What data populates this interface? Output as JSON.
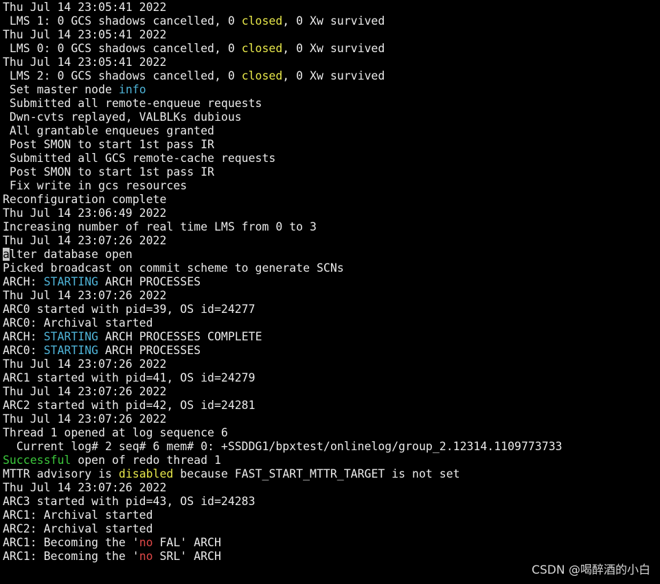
{
  "colors": {
    "background": "#000000",
    "text": "#ebebeb",
    "yellow": "#e8e84a",
    "cyan": "#4fb4d8",
    "green": "#3cc83c",
    "red": "#e04848",
    "cursor": "#c8c8c8"
  },
  "lines": [
    [
      {
        "t": "Thu Jul 14 23:05:41 2022"
      }
    ],
    [
      {
        "t": " LMS 1: 0 GCS shadows cancelled, 0 "
      },
      {
        "t": "closed",
        "c": "yellow"
      },
      {
        "t": ", 0 Xw survived"
      }
    ],
    [
      {
        "t": "Thu Jul 14 23:05:41 2022"
      }
    ],
    [
      {
        "t": " LMS 0: 0 GCS shadows cancelled, 0 "
      },
      {
        "t": "closed",
        "c": "yellow"
      },
      {
        "t": ", 0 Xw survived"
      }
    ],
    [
      {
        "t": "Thu Jul 14 23:05:41 2022"
      }
    ],
    [
      {
        "t": " LMS 2: 0 GCS shadows cancelled, 0 "
      },
      {
        "t": "closed",
        "c": "yellow"
      },
      {
        "t": ", 0 Xw survived"
      }
    ],
    [
      {
        "t": " Set master node "
      },
      {
        "t": "info",
        "c": "cyan"
      }
    ],
    [
      {
        "t": " Submitted all remote-enqueue requests"
      }
    ],
    [
      {
        "t": " Dwn-cvts replayed, VALBLKs dubious"
      }
    ],
    [
      {
        "t": " All grantable enqueues granted"
      }
    ],
    [
      {
        "t": " Post SMON to start 1st pass IR"
      }
    ],
    [
      {
        "t": " Submitted all GCS remote-cache requests"
      }
    ],
    [
      {
        "t": " Post SMON to start 1st pass IR"
      }
    ],
    [
      {
        "t": " Fix write in gcs resources"
      }
    ],
    [
      {
        "t": "Reconfiguration complete"
      }
    ],
    [
      {
        "t": "Thu Jul 14 23:06:49 2022"
      }
    ],
    [
      {
        "t": "Increasing number of real time LMS from 0 to 3"
      }
    ],
    [
      {
        "t": "Thu Jul 14 23:07:26 2022"
      }
    ],
    [
      {
        "t": "a",
        "c": "cursor"
      },
      {
        "t": "lter database open"
      }
    ],
    [
      {
        "t": "Picked broadcast on commit scheme to generate SCNs"
      }
    ],
    [
      {
        "t": "ARCH: "
      },
      {
        "t": "STARTING",
        "c": "cyan"
      },
      {
        "t": " ARCH PROCESSES"
      }
    ],
    [
      {
        "t": "Thu Jul 14 23:07:26 2022"
      }
    ],
    [
      {
        "t": "ARC0 started with pid=39, OS id=24277"
      }
    ],
    [
      {
        "t": "ARC0: Archival started"
      }
    ],
    [
      {
        "t": "ARCH: "
      },
      {
        "t": "STARTING",
        "c": "cyan"
      },
      {
        "t": " ARCH PROCESSES COMPLETE"
      }
    ],
    [
      {
        "t": "ARC0: "
      },
      {
        "t": "STARTING",
        "c": "cyan"
      },
      {
        "t": " ARCH PROCESSES"
      }
    ],
    [
      {
        "t": "Thu Jul 14 23:07:26 2022"
      }
    ],
    [
      {
        "t": "ARC1 started with pid=41, OS id=24279"
      }
    ],
    [
      {
        "t": "Thu Jul 14 23:07:26 2022"
      }
    ],
    [
      {
        "t": "ARC2 started with pid=42, OS id=24281"
      }
    ],
    [
      {
        "t": "Thu Jul 14 23:07:26 2022"
      }
    ],
    [
      {
        "t": "Thread 1 opened at log sequence 6"
      }
    ],
    [
      {
        "t": "  Current log# 2 seq# 6 mem# 0: +SSDDG1/bpxtest/onlinelog/group_2.12314.1109773733"
      }
    ],
    [
      {
        "t": "Successful",
        "c": "green"
      },
      {
        "t": " open of redo thread 1"
      }
    ],
    [
      {
        "t": "MTTR advisory is "
      },
      {
        "t": "disabled",
        "c": "yellow"
      },
      {
        "t": " because FAST_START_MTTR_TARGET is not set"
      }
    ],
    [
      {
        "t": "Thu Jul 14 23:07:26 2022"
      }
    ],
    [
      {
        "t": "ARC3 started with pid=43, OS id=24283"
      }
    ],
    [
      {
        "t": "ARC1: Archival started"
      }
    ],
    [
      {
        "t": "ARC2: Archival started"
      }
    ],
    [
      {
        "t": "ARC1: Becoming the '"
      },
      {
        "t": "no",
        "c": "red"
      },
      {
        "t": " FAL' ARCH"
      }
    ],
    [
      {
        "t": "ARC1: Becoming the '"
      },
      {
        "t": "no",
        "c": "red"
      },
      {
        "t": " SRL' ARCH"
      }
    ]
  ],
  "watermark": "CSDN @喝醉酒的小白"
}
